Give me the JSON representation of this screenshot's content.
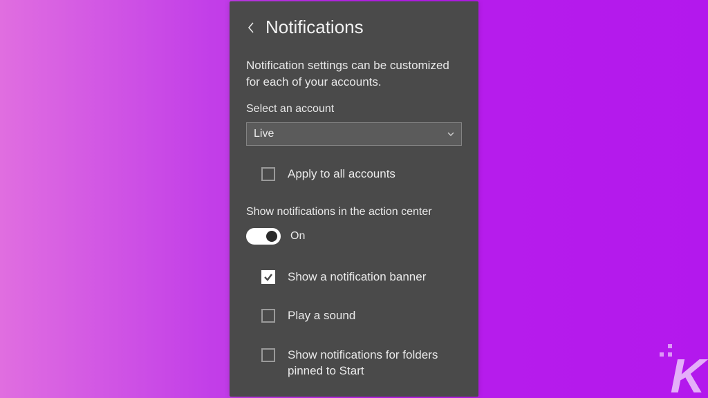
{
  "header": {
    "title": "Notifications"
  },
  "description": "Notification settings can be customized for each of your accounts.",
  "account": {
    "label": "Select an account",
    "selected": "Live"
  },
  "apply_all": {
    "label": "Apply to all accounts",
    "checked": false
  },
  "action_center": {
    "label": "Show notifications in the action center",
    "state_label": "On",
    "enabled": true
  },
  "options": {
    "banner": {
      "label": "Show a notification banner",
      "checked": true
    },
    "sound": {
      "label": "Play a sound",
      "checked": false
    },
    "folders": {
      "label": "Show notifications for folders pinned to Start",
      "checked": false
    }
  },
  "watermark": {
    "letter": "K"
  }
}
